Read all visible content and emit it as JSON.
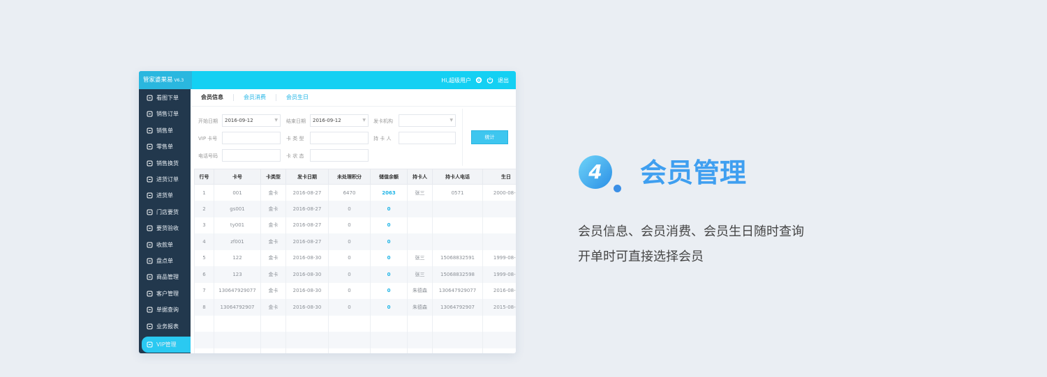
{
  "app": {
    "brand": "管家婆果易",
    "version": "V6.3",
    "greeting": "Hi,超级用户",
    "logout": "退出"
  },
  "sidebar": {
    "items": [
      {
        "label": "看图下单",
        "icon": "image-order-icon"
      },
      {
        "label": "销售订单",
        "icon": "sales-order-icon"
      },
      {
        "label": "销售单",
        "icon": "sales-doc-icon"
      },
      {
        "label": "零售单",
        "icon": "retail-doc-icon"
      },
      {
        "label": "销售换货",
        "icon": "exchange-icon"
      },
      {
        "label": "进货订单",
        "icon": "purchase-order-icon"
      },
      {
        "label": "进货单",
        "icon": "purchase-doc-icon"
      },
      {
        "label": "门店要货",
        "icon": "store-icon"
      },
      {
        "label": "要货验收",
        "icon": "inspect-icon"
      },
      {
        "label": "收款单",
        "icon": "receipt-icon"
      },
      {
        "label": "盘点单",
        "icon": "stocktake-icon"
      },
      {
        "label": "商品管理",
        "icon": "goods-icon"
      },
      {
        "label": "客户管理",
        "icon": "customer-icon"
      },
      {
        "label": "单据查询",
        "icon": "query-icon"
      },
      {
        "label": "业务报表",
        "icon": "report-icon"
      },
      {
        "label": "VIP管理",
        "icon": "vip-icon",
        "active": true
      }
    ]
  },
  "tabs": [
    {
      "label": "会员信息",
      "current": true
    },
    {
      "label": "会员消费"
    },
    {
      "label": "会员生日"
    }
  ],
  "filters": {
    "start_date_label": "开始日期",
    "start_date_value": "2016-09-12",
    "end_date_label": "结束日期",
    "end_date_value": "2016-09-12",
    "issuer_label": "发卡机构",
    "vip_no_label": "VIP 卡号",
    "card_type_label": "卡 类 型",
    "holder_label": "持 卡 人",
    "phone_label": "电话号码",
    "card_status_label": "卡 状 态",
    "stat_button": "统计"
  },
  "table": {
    "headers": [
      "行号",
      "卡号",
      "卡类型",
      "发卡日期",
      "未处理积分",
      "储值余额",
      "持卡人",
      "持卡人电话",
      "生日"
    ],
    "rows": [
      [
        "1",
        "001",
        "金卡",
        "2016-08-27",
        "6470",
        "2063",
        "张三",
        "0571",
        "2000-08-2"
      ],
      [
        "2",
        "gs001",
        "金卡",
        "2016-08-27",
        "0",
        "0",
        "",
        "",
        ""
      ],
      [
        "3",
        "ty001",
        "金卡",
        "2016-08-27",
        "0",
        "0",
        "",
        "",
        ""
      ],
      [
        "4",
        "zf001",
        "金卡",
        "2016-08-27",
        "0",
        "0",
        "",
        "",
        ""
      ],
      [
        "5",
        "122",
        "金卡",
        "2016-08-30",
        "0",
        "0",
        "张三",
        "15068832591",
        "1999-08-0"
      ],
      [
        "6",
        "123",
        "金卡",
        "2016-08-30",
        "0",
        "0",
        "张三",
        "15068832598",
        "1999-08-0"
      ],
      [
        "7",
        "13064792907​7",
        "金卡",
        "2016-08-30",
        "0",
        "0",
        "朱德森",
        "130647929077",
        "2016-08-3"
      ],
      [
        "8",
        "13064792907",
        "金卡",
        "2016-08-30",
        "0",
        "0",
        "朱德森",
        "13064792907",
        "2015-08-2"
      ]
    ]
  },
  "feature": {
    "number": "4",
    "title": "会员管理",
    "line1": "会员信息、会员消费、会员生日随时查询",
    "line2": "开单时可直接选择会员"
  },
  "colors": {
    "topbar": "#14d0f3",
    "sidebar": "#22384d",
    "accent": "#1fb4e6",
    "title": "#3f9ff0"
  }
}
